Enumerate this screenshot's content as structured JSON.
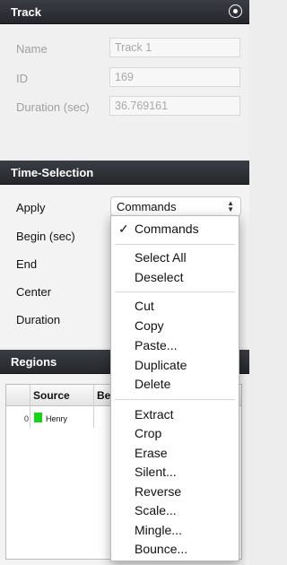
{
  "track": {
    "header": "Track",
    "fields": [
      {
        "label": "Name",
        "value": "Track 1"
      },
      {
        "label": "ID",
        "value": "169"
      },
      {
        "label": "Duration (sec)",
        "value": "36.769161"
      }
    ]
  },
  "time_selection": {
    "header": "Time-Selection",
    "apply_label": "Apply",
    "apply_value": "Commands",
    "labels": [
      "Begin (sec)",
      "End",
      "Center",
      "Duration"
    ]
  },
  "regions": {
    "header": "Regions",
    "columns": [
      "Source",
      "Be"
    ],
    "rows": [
      {
        "index": "0",
        "name": "Henry",
        "color": "#19d319"
      }
    ]
  },
  "menu": {
    "checked": "Commands",
    "groups": [
      [
        "Commands"
      ],
      [
        "Select All",
        "Deselect"
      ],
      [
        "Cut",
        "Copy",
        "Paste...",
        "Duplicate",
        "Delete"
      ],
      [
        "Extract",
        "Crop",
        "Erase",
        "Silent...",
        "Reverse",
        "Scale...",
        "Mingle...",
        "Bounce..."
      ]
    ]
  }
}
